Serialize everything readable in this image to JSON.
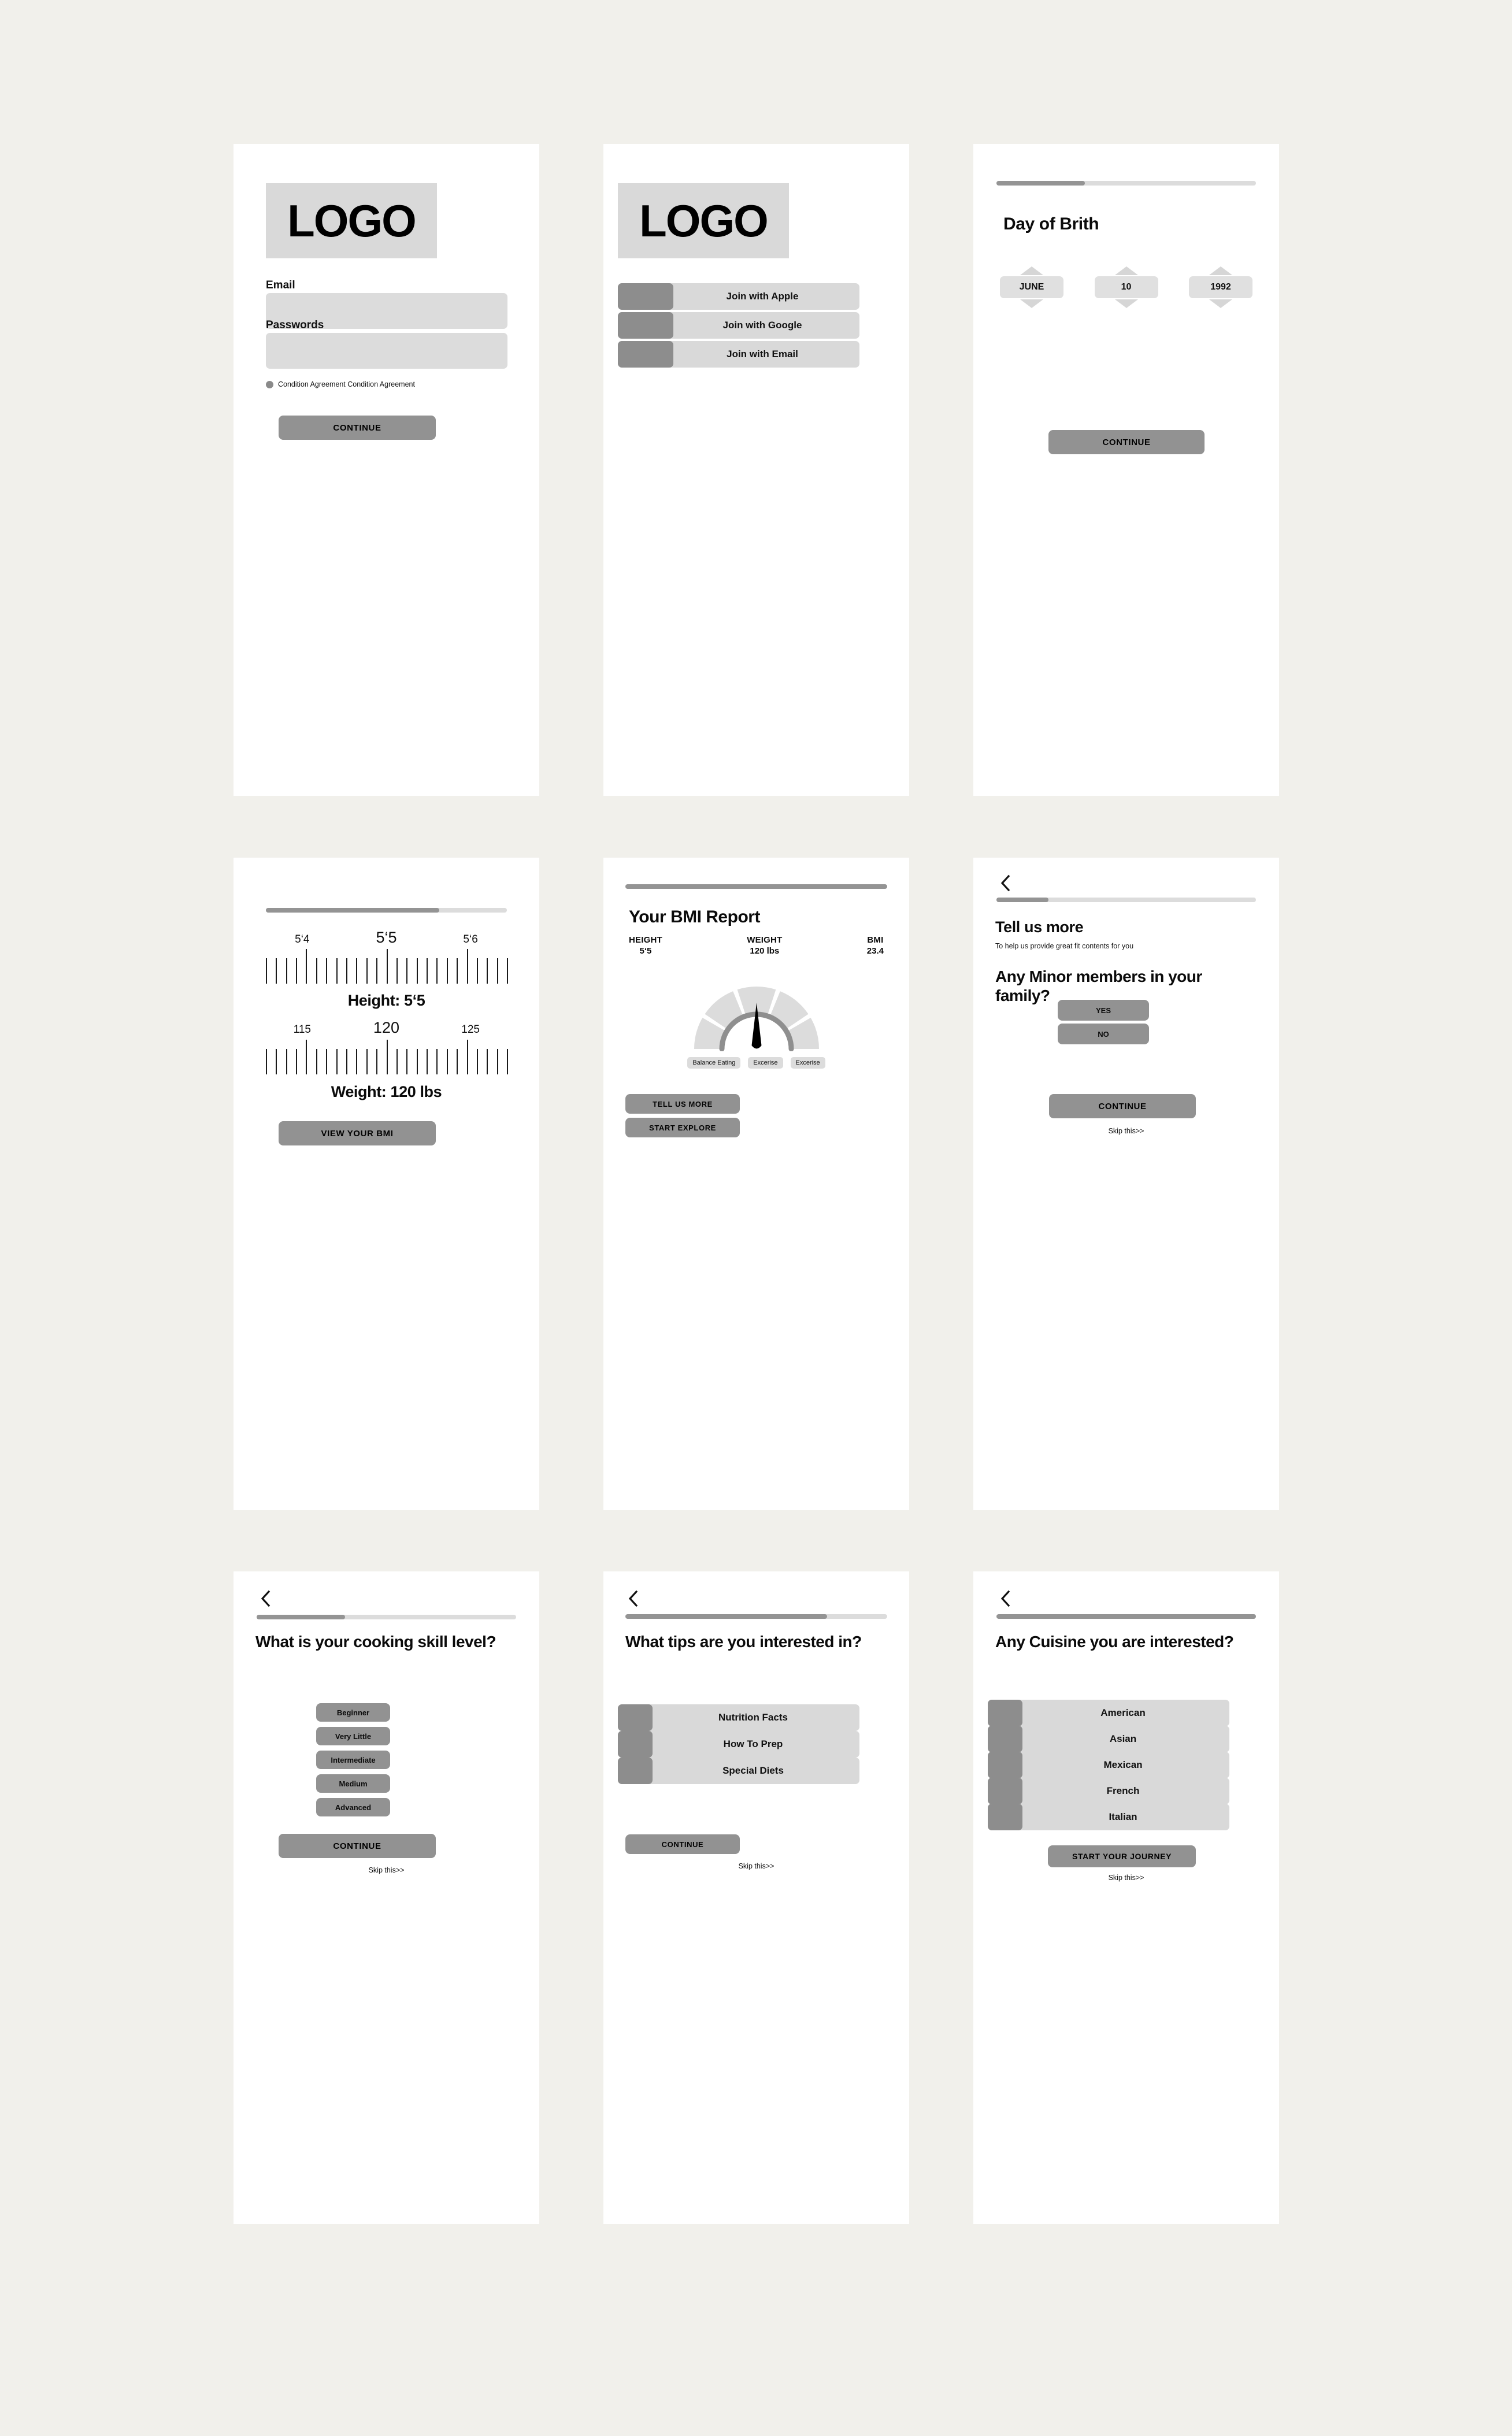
{
  "theme": {
    "canvas_bg": "#f1f0eb",
    "card_bg": "#ffffff",
    "placeholder_gray": "#d9d9d9",
    "button_gray": "#929292",
    "thumb_gray": "#8d8d8d",
    "progress_fill": "#949494",
    "progress_track": "#dcdcdc",
    "text": "#0b0b0b"
  },
  "screens": {
    "login": {
      "logo": "LOGO",
      "email_label": "Email",
      "email_value": "",
      "email_placeholder": "",
      "password_label": "Passwords",
      "password_value": "",
      "password_placeholder": "",
      "agreement": "Condition Agreement Condition Agreement",
      "continue_label": "CONTINUE"
    },
    "signup": {
      "logo": "LOGO",
      "options": [
        {
          "label": "Join with Apple",
          "icon": "apple-icon"
        },
        {
          "label": "Join with Google",
          "icon": "google-icon"
        },
        {
          "label": "Join with Email",
          "icon": "email-icon"
        }
      ]
    },
    "birthday": {
      "progress_percent": 34,
      "title": "Day of Brith",
      "spinners": [
        {
          "name": "month",
          "value": "JUNE"
        },
        {
          "name": "day",
          "value": "10"
        },
        {
          "name": "year",
          "value": "1992"
        }
      ],
      "continue_label": "CONTINUE"
    },
    "measurements": {
      "progress_percent": 72,
      "height_ticks": {
        "left": "5‘4",
        "center": "5‘5",
        "right": "5‘6"
      },
      "height_readout": "Height: 5‘5",
      "weight_ticks": {
        "left": "115",
        "center": "120",
        "right": "125"
      },
      "weight_readout": "Weight: 120 lbs",
      "cta_label": "VIEW YOUR BMI"
    },
    "bmi_report": {
      "progress_percent": 100,
      "title": "Your BMI Report",
      "stats": [
        {
          "key": "HEIGHT",
          "value": "5‘5"
        },
        {
          "key": "WEIGHT",
          "value": "120 lbs"
        },
        {
          "key": "BMI",
          "value": "23.4"
        }
      ],
      "tags": [
        "Balance Eating",
        "Excerise",
        "Excerise"
      ],
      "primary_label": "TELL US MORE",
      "secondary_label": "START EXPLORE"
    },
    "tell_us_more": {
      "back_icon": "chevron-left-icon",
      "progress_percent": 20,
      "eyebrow_title": "Tell us more",
      "eyebrow_sub": "To help us provide great fit contents for you",
      "heading": "Any Minor members in your family?",
      "answers": [
        "YES",
        "NO"
      ],
      "continue_label": "CONTINUE",
      "skip_label": "Skip this>>"
    },
    "cooking_skill": {
      "back_icon": "chevron-left-icon",
      "progress_percent": 34,
      "heading": "What is your cooking skill level?",
      "options": [
        "Beginner",
        "Very Little",
        "Intermediate",
        "Medium",
        "Advanced"
      ],
      "continue_label": "CONTINUE",
      "skip_label": "Skip this>>"
    },
    "tips": {
      "back_icon": "chevron-left-icon",
      "progress_percent": 77,
      "heading": "What tips are you interested in?",
      "options": [
        "Nutrition Facts",
        "How To Prep",
        "Special Diets"
      ],
      "continue_label": "CONTINUE",
      "skip_label": "Skip this>>"
    },
    "cuisine": {
      "back_icon": "chevron-left-icon",
      "progress_percent": 100,
      "heading": "Any Cuisine you are interested?",
      "options": [
        "American",
        "Asian",
        "Mexican",
        "French",
        "Italian"
      ],
      "cta_label": "START YOUR JOURNEY",
      "skip_label": "Skip this>>"
    }
  }
}
